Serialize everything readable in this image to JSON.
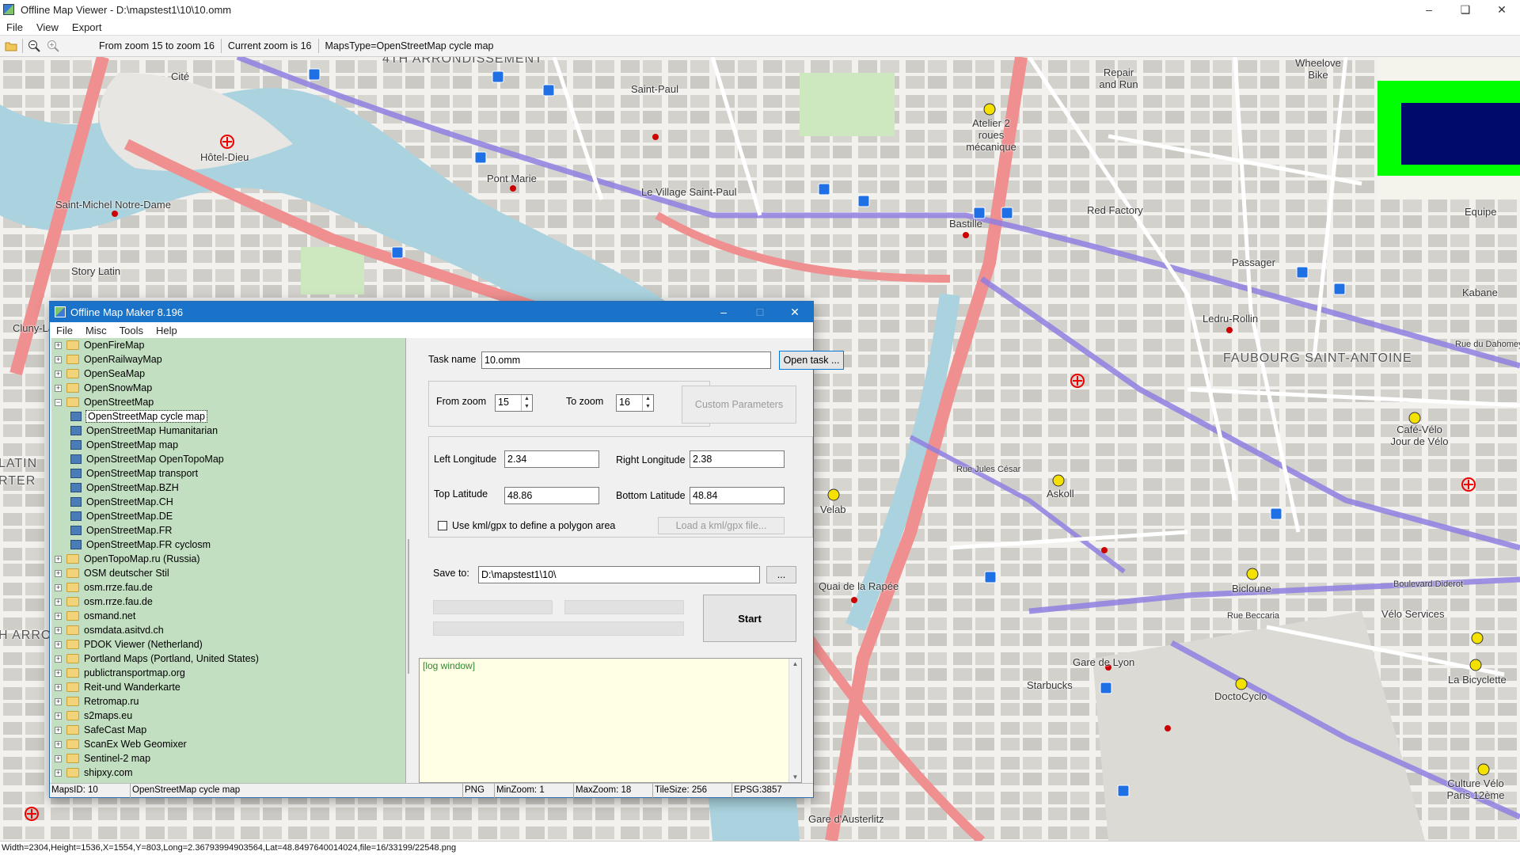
{
  "window": {
    "title": "Offline Map Viewer - D:\\mapstest1\\10\\10.omm",
    "menu": [
      "File",
      "View",
      "Export"
    ],
    "toolbar": {
      "zoom_range": "From zoom 15 to zoom 16",
      "current_zoom": "Current zoom is 16",
      "maps_type": "MapsType=OpenStreetMap cycle map"
    },
    "status": "Width=2304,Height=1536,X=1554,Y=803,Long=2.36793994903564,Lat=48.8497640014024,file=16/33199/22548.png"
  },
  "map": {
    "labels": [
      {
        "text": "4TH ARRONDISSEMENT",
        "big": true
      },
      {
        "text": "Cité"
      },
      {
        "text": "Hôtel-Dieu"
      },
      {
        "text": "Saint-Michel Notre-Dame"
      },
      {
        "text": "Pont Marie"
      },
      {
        "text": "Saint-Paul"
      },
      {
        "text": "Le Village Saint-Paul"
      },
      {
        "text": "Bastille"
      },
      {
        "text": "Atelier 2 roues mécanique"
      },
      {
        "text": "Repair and Run"
      },
      {
        "text": "Wheelove Bike"
      },
      {
        "text": "Red Factory"
      },
      {
        "text": "Passager"
      },
      {
        "text": "Ledru-Rollin"
      },
      {
        "text": "FAUBOURG SAINT-ANTOINE",
        "big": true
      },
      {
        "text": "Kabane"
      },
      {
        "text": "Café-Vélo Jour de Vélo"
      },
      {
        "text": "Askoll"
      },
      {
        "text": "Velab"
      },
      {
        "text": "Quai de la Rapée"
      },
      {
        "text": "Bicloune"
      },
      {
        "text": "Vélo Services"
      },
      {
        "text": "Gare de Lyon"
      },
      {
        "text": "Starbucks"
      },
      {
        "text": "DoctoCyclo"
      },
      {
        "text": "La Bicyclette"
      },
      {
        "text": "Culture Vélo Paris 12ème"
      },
      {
        "text": "Gare d'Austerlitz"
      },
      {
        "text": "Story Latin"
      },
      {
        "text": "Cluny-La"
      },
      {
        "text": "LATIN"
      },
      {
        "text": "RTER"
      },
      {
        "text": "H ARRO"
      },
      {
        "text": "Equipe"
      },
      {
        "text": "Boulevard Diderot"
      },
      {
        "text": "Rue Jules César"
      },
      {
        "text": "Rue du Dahomey"
      },
      {
        "text": "Rue Beccaria"
      }
    ]
  },
  "dialog": {
    "title": "Offline Map Maker 8.196",
    "menu": [
      "File",
      "Misc",
      "Tools",
      "Help"
    ],
    "tree": [
      {
        "label": "OpenFireMap",
        "level": 0,
        "type": "folder"
      },
      {
        "label": "OpenRailwayMap",
        "level": 0,
        "type": "folder"
      },
      {
        "label": "OpenSeaMap",
        "level": 0,
        "type": "folder"
      },
      {
        "label": "OpenSnowMap",
        "level": 0,
        "type": "folder"
      },
      {
        "label": "OpenStreetMap",
        "level": 0,
        "type": "folder-open"
      },
      {
        "label": "OpenStreetMap cycle map",
        "level": 1,
        "type": "map",
        "selected": true
      },
      {
        "label": "OpenStreetMap Humanitarian",
        "level": 1,
        "type": "map"
      },
      {
        "label": "OpenStreetMap map",
        "level": 1,
        "type": "map"
      },
      {
        "label": "OpenStreetMap OpenTopoMap",
        "level": 1,
        "type": "map"
      },
      {
        "label": "OpenStreetMap transport",
        "level": 1,
        "type": "map"
      },
      {
        "label": "OpenStreetMap.BZH",
        "level": 1,
        "type": "map"
      },
      {
        "label": "OpenStreetMap.CH",
        "level": 1,
        "type": "map"
      },
      {
        "label": "OpenStreetMap.DE",
        "level": 1,
        "type": "map"
      },
      {
        "label": "OpenStreetMap.FR",
        "level": 1,
        "type": "map"
      },
      {
        "label": "OpenStreetMap.FR cyclosm",
        "level": 1,
        "type": "map"
      },
      {
        "label": "OpenTopoMap.ru (Russia)",
        "level": 0,
        "type": "folder"
      },
      {
        "label": "OSM deutscher Stil",
        "level": 0,
        "type": "folder"
      },
      {
        "label": "osm.rrze.fau.de",
        "level": 0,
        "type": "folder"
      },
      {
        "label": "osm.rrze.fau.de",
        "level": 0,
        "type": "folder"
      },
      {
        "label": "osmand.net",
        "level": 0,
        "type": "folder"
      },
      {
        "label": "osmdata.asitvd.ch",
        "level": 0,
        "type": "folder"
      },
      {
        "label": "PDOK Viewer (Netherland)",
        "level": 0,
        "type": "folder"
      },
      {
        "label": "Portland Maps (Portland, United States)",
        "level": 0,
        "type": "folder"
      },
      {
        "label": "publictransportmap.org",
        "level": 0,
        "type": "folder"
      },
      {
        "label": "Reit-und Wanderkarte",
        "level": 0,
        "type": "folder"
      },
      {
        "label": "Retromap.ru",
        "level": 0,
        "type": "folder"
      },
      {
        "label": "s2maps.eu",
        "level": 0,
        "type": "folder"
      },
      {
        "label": "SafeCast Map",
        "level": 0,
        "type": "folder"
      },
      {
        "label": "ScanEx Web Geomixer",
        "level": 0,
        "type": "folder"
      },
      {
        "label": "Sentinel-2 map",
        "level": 0,
        "type": "folder"
      },
      {
        "label": "shipxy.com",
        "level": 0,
        "type": "folder"
      }
    ],
    "task_name_label": "Task name",
    "task_name": "10.omm",
    "open_task": "Open task ...",
    "from_zoom_label": "From zoom",
    "from_zoom": "15",
    "to_zoom_label": "To zoom",
    "to_zoom": "16",
    "custom_params": "Custom Parameters",
    "left_lon_label": "Left Longitude",
    "left_lon": "2.34",
    "right_lon_label": "Right Longitude",
    "right_lon": "2.38",
    "top_lat_label": "Top Latitude",
    "top_lat": "48.86",
    "bottom_lat_label": "Bottom Latitude",
    "bottom_lat": "48.84",
    "kml_checkbox": "Use kml/gpx to define a polygon area",
    "kml_checked": false,
    "load_kml": "Load a kml/gpx file...",
    "save_to_label": "Save to:",
    "save_to": "D:\\mapstest1\\10\\",
    "browse": "...",
    "start": "Start",
    "log": "[log window]",
    "status": {
      "maps_id": "MapsID: 10",
      "map_name": "OpenStreetMap cycle map",
      "format": "PNG",
      "min_zoom": "MinZoom: 1",
      "max_zoom": "MaxZoom: 18",
      "tile_size": "TileSize: 256",
      "epsg": "EPSG:3857"
    }
  },
  "colors": {
    "river": "#aad3df",
    "main_road": "#ef8f8f",
    "cycle_route": "#8f7fe0",
    "building": "#c9c7c2",
    "tree_bg": "#c3dfc2",
    "dialog_titlebar": "#1a73c8",
    "log_bg": "#ffffe6"
  }
}
